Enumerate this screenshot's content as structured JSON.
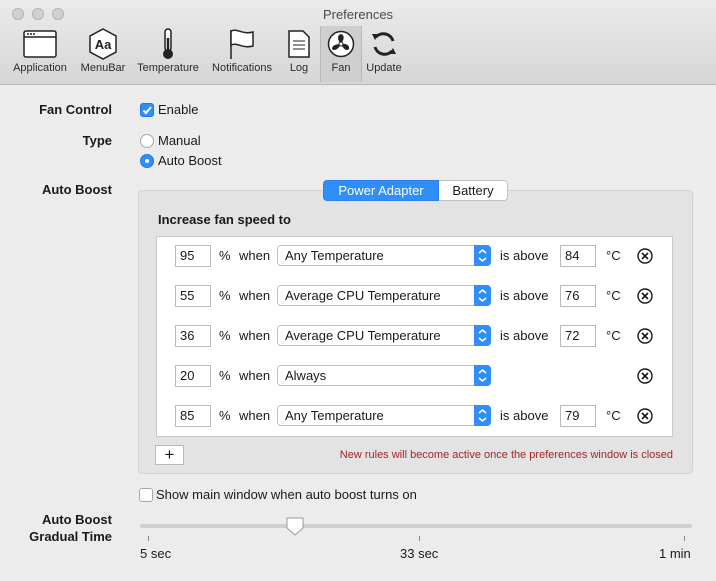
{
  "window": {
    "title": "Preferences"
  },
  "toolbar": [
    {
      "label": "Application",
      "icon": "window-icon"
    },
    {
      "label": "MenuBar",
      "icon": "font-aa-icon"
    },
    {
      "label": "Temperature",
      "icon": "thermometer-icon"
    },
    {
      "label": "Notifications",
      "icon": "flag-icon"
    },
    {
      "label": "Log",
      "icon": "document-icon"
    },
    {
      "label": "Fan",
      "icon": "fan-icon",
      "selected": true
    },
    {
      "label": "Update",
      "icon": "refresh-icon"
    }
  ],
  "fan_control": {
    "label": "Fan Control",
    "enable_label": "Enable",
    "enabled": true
  },
  "type": {
    "label": "Type",
    "options": [
      "Manual",
      "Auto Boost"
    ],
    "selected": "Auto Boost"
  },
  "auto_boost": {
    "label": "Auto Boost",
    "tabs": [
      "Power Adapter",
      "Battery"
    ],
    "active_tab": "Power Adapter",
    "heading": "Increase fan speed to",
    "percent_symbol": "%",
    "when_text": "when",
    "above_text": "is above",
    "unit": "°C",
    "rules": [
      {
        "percent": "95",
        "condition": "Any Temperature",
        "threshold": "84"
      },
      {
        "percent": "55",
        "condition": "Average CPU Temperature",
        "threshold": "76"
      },
      {
        "percent": "36",
        "condition": "Average CPU Temperature",
        "threshold": "72"
      },
      {
        "percent": "20",
        "condition": "Always",
        "threshold": ""
      },
      {
        "percent": "85",
        "condition": "Any Temperature",
        "threshold": "79"
      }
    ],
    "add_label": "+",
    "note": "New rules will become active once the preferences window is closed"
  },
  "show_main_window": {
    "label": "Show main window when auto boost turns on",
    "checked": false
  },
  "gradual": {
    "label_line1": "Auto Boost",
    "label_line2": "Gradual Time",
    "min_label": "5 sec",
    "mid_label": "33 sec",
    "max_label": "1 min",
    "value_fraction": 0.28
  },
  "colors": {
    "accent": "#2f8ff8",
    "note": "#a32626"
  }
}
